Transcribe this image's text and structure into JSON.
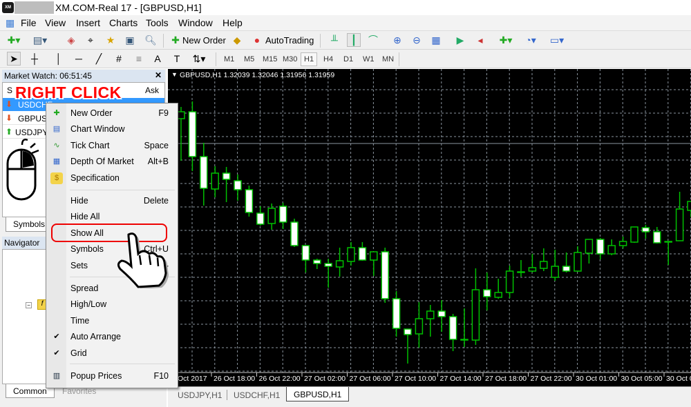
{
  "window": {
    "title": "XM.COM-Real 17 - [GBPUSD,H1]",
    "logo_text": "XM"
  },
  "menu": [
    "File",
    "View",
    "Insert",
    "Charts",
    "Tools",
    "Window",
    "Help"
  ],
  "toolbar": {
    "new_order": "New Order",
    "autotrading": "AutoTrading"
  },
  "timeframes": [
    "M1",
    "M5",
    "M15",
    "M30",
    "H1",
    "H4",
    "D1",
    "W1",
    "MN"
  ],
  "active_timeframe": "H1",
  "market_watch": {
    "title": "Market Watch: 06:51:45",
    "col_ask": "Ask",
    "col_symbol": "S",
    "rows": [
      {
        "symbol": "USDCHF",
        "dir": "down"
      },
      {
        "symbol": "GBPUSD",
        "dir": "down"
      },
      {
        "symbol": "USDJPY",
        "dir": "up"
      }
    ],
    "tab": "Symbols"
  },
  "navigator": {
    "title": "Navigator",
    "tabs": [
      "Common",
      "Favorites"
    ]
  },
  "context_menu": {
    "items": [
      {
        "label": "New Order",
        "shortcut": "F9",
        "icon": "new-order-icon"
      },
      {
        "label": "Chart Window",
        "shortcut": "",
        "icon": "chart-window-icon"
      },
      {
        "label": "Tick Chart",
        "shortcut": "Space",
        "icon": "tick-chart-icon"
      },
      {
        "label": "Depth Of Market",
        "shortcut": "Alt+B",
        "icon": "depth-of-market-icon"
      },
      {
        "label": "Specification",
        "shortcut": "",
        "icon": "dollar-icon"
      },
      {
        "label": "Hide",
        "shortcut": "Delete"
      },
      {
        "label": "Hide All",
        "shortcut": ""
      },
      {
        "label": "Show All",
        "shortcut": "",
        "highlighted": true
      },
      {
        "label": "Symbols",
        "shortcut": "Ctrl+U"
      },
      {
        "label": "Sets",
        "shortcut": "",
        "submenu": true
      },
      {
        "label": "Spread",
        "shortcut": ""
      },
      {
        "label": "High/Low",
        "shortcut": ""
      },
      {
        "label": "Time",
        "shortcut": ""
      },
      {
        "label": "Auto Arrange",
        "shortcut": "",
        "checked": true
      },
      {
        "label": "Grid",
        "shortcut": "",
        "checked": true
      },
      {
        "label": "Popup Prices",
        "shortcut": "F10",
        "icon": "popup-prices-icon"
      }
    ]
  },
  "annotation": {
    "text": "RIGHT CLICK",
    "color": "#ff0000"
  },
  "chart_tabs": [
    "USDJPY,H1",
    "USDCHF,H1",
    "GBPUSD,H1"
  ],
  "active_chart_tab": "GBPUSD,H1",
  "chart_data": {
    "type": "candlestick",
    "title": "GBPUSD,H1  1.32039 1.32046 1.31956 1.31959",
    "symbol": "GBPUSD,H1",
    "colors": {
      "background": "#000000",
      "up_body": "#000000",
      "down_body": "#ffffff",
      "outline": "#00c000",
      "grid": "#8c96a0"
    },
    "grid": true,
    "x_tick_labels": [
      "Oct 2017",
      "26 Oct 18:00",
      "26 Oct 22:00",
      "27 Oct 02:00",
      "27 Oct 06:00",
      "27 Oct 10:00",
      "27 Oct 14:00",
      "27 Oct 18:00",
      "27 Oct 22:00",
      "30 Oct 01:00",
      "30 Oct 05:00",
      "30 Oct 0"
    ],
    "ohlc": [
      [
        1.32784,
        1.32835,
        1.32601,
        1.32814
      ],
      [
        1.32814,
        1.32859,
        1.32556,
        1.32619
      ],
      [
        1.32619,
        1.32679,
        1.32406,
        1.32481
      ],
      [
        1.32478,
        1.32577,
        1.32442,
        1.32547
      ],
      [
        1.32547,
        1.32574,
        1.32421,
        1.3252
      ],
      [
        1.32514,
        1.32541,
        1.32427,
        1.32475
      ],
      [
        1.32475,
        1.32493,
        1.32358,
        1.32376
      ],
      [
        1.32373,
        1.32403,
        1.32319,
        1.32325
      ],
      [
        1.32328,
        1.32415,
        1.32301,
        1.32394
      ],
      [
        1.32403,
        1.32418,
        1.32304,
        1.32334
      ],
      [
        1.32334,
        1.32349,
        1.32226,
        1.32232
      ],
      [
        1.32232,
        1.32232,
        1.32115,
        1.32169
      ],
      [
        1.32169,
        1.32175,
        1.3213,
        1.32154
      ],
      [
        1.32154,
        1.32175,
        1.32049,
        1.32142
      ],
      [
        1.32139,
        1.32223,
        1.32097,
        1.32166
      ],
      [
        1.32163,
        1.32247,
        1.32145,
        1.32223
      ],
      [
        1.32223,
        1.32247,
        1.32166,
        1.32169
      ],
      [
        1.32169,
        1.32205,
        1.321,
        1.32205
      ],
      [
        1.32205,
        1.32223,
        1.31983,
        1.32001
      ],
      [
        1.32001,
        1.32034,
        1.31836,
        1.31872
      ],
      [
        1.31869,
        1.31869,
        1.31719,
        1.31845
      ],
      [
        1.31848,
        1.31986,
        1.31788,
        1.31914
      ],
      [
        1.31914,
        1.31974,
        1.31836,
        1.31947
      ],
      [
        1.31947,
        1.31995,
        1.31857,
        1.31923
      ],
      [
        1.31923,
        1.31935,
        1.31773,
        1.31824
      ],
      [
        1.31824,
        1.31959,
        1.31791,
        1.31824
      ],
      [
        1.31821,
        1.32133,
        1.318,
        1.3204
      ],
      [
        1.3204,
        1.32115,
        1.3195,
        1.3201
      ],
      [
        1.32007,
        1.32088,
        1.32001,
        1.32028
      ],
      [
        1.32028,
        1.32145,
        1.32004,
        1.32121
      ],
      [
        1.32118,
        1.32169,
        1.32097,
        1.32118
      ],
      [
        1.32121,
        1.32196,
        1.32115,
        1.32136
      ],
      [
        1.32133,
        1.3222,
        1.32121,
        1.32163
      ],
      [
        1.32094,
        1.32214,
        1.32079,
        1.32142
      ],
      [
        1.32142,
        1.32202,
        1.32115,
        1.32121
      ],
      [
        1.32121,
        1.32229,
        1.32118,
        1.32202
      ],
      [
        1.32199,
        1.32259,
        1.32154,
        1.32259
      ],
      [
        1.32259,
        1.32265,
        1.32172,
        1.32196
      ],
      [
        1.32196,
        1.32259,
        1.3219,
        1.32232
      ],
      [
        1.32232,
        1.32271,
        1.3222,
        1.3225
      ],
      [
        1.32247,
        1.32313,
        1.32244,
        1.32313
      ],
      [
        1.3231,
        1.32322,
        1.32262,
        1.32292
      ],
      [
        1.32292,
        1.32313,
        1.32241,
        1.32244
      ],
      [
        1.3225,
        1.3225,
        1.32148,
        1.3225
      ],
      [
        1.32253,
        1.32466,
        1.32253,
        1.32391
      ],
      [
        1.32385,
        1.32424,
        1.32355,
        1.32424
      ]
    ],
    "price_line": 1.32676
  }
}
